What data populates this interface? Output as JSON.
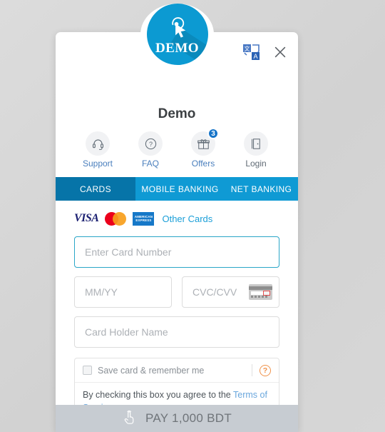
{
  "window": {
    "background_color": "#d6d6d6"
  },
  "header": {
    "logo": {
      "icon": "click-cursor-icon",
      "text": "DEMO",
      "color": "#0c9ad2"
    },
    "translate_icon": "translate-icon",
    "close_icon": "close-icon",
    "merchant_title": "Demo"
  },
  "nav": {
    "items": [
      {
        "icon": "headset-icon",
        "label": "Support",
        "badge": ""
      },
      {
        "icon": "question-mark-icon",
        "label": "FAQ",
        "badge": ""
      },
      {
        "icon": "gift-icon",
        "label": "Offers",
        "badge": "3"
      },
      {
        "icon": "door-login-icon",
        "label": "Login",
        "badge": ""
      }
    ]
  },
  "tabs": {
    "active": "CARDS",
    "items": [
      {
        "label": "CARDS"
      },
      {
        "label": "MOBILE BANKING"
      },
      {
        "label": "NET BANKING"
      }
    ],
    "active_color": "#0674a8",
    "bar_color": "#0f9ad4"
  },
  "card_form": {
    "brands": [
      {
        "name": "visa-logo",
        "label": "VISA"
      },
      {
        "name": "mastercard-logo",
        "label": ""
      },
      {
        "name": "amex-logo",
        "label": "AMERICAN EXPRESS"
      }
    ],
    "other_cards_label": "Other Cards",
    "card_number": {
      "value": "",
      "placeholder": "Enter Card Number",
      "focused": true
    },
    "expiry": {
      "value": "",
      "placeholder": "MM/YY"
    },
    "cvc": {
      "value": "",
      "placeholder": "CVC/CVV",
      "hint_icon": "card-back-cvc-icon"
    },
    "card_holder": {
      "value": "",
      "placeholder": "Card Holder Name"
    },
    "save_card": {
      "checked": false,
      "label": "Save card & remember me",
      "help_icon": "question-help-icon",
      "agreement_prefix": "By checking this box you agree to the ",
      "agreement_link": "Terms of Service"
    }
  },
  "pay_button": {
    "icon": "tap-hand-icon",
    "label": "PAY 1,000 BDT",
    "enabled": false,
    "background_color": "#c7ccd2"
  }
}
